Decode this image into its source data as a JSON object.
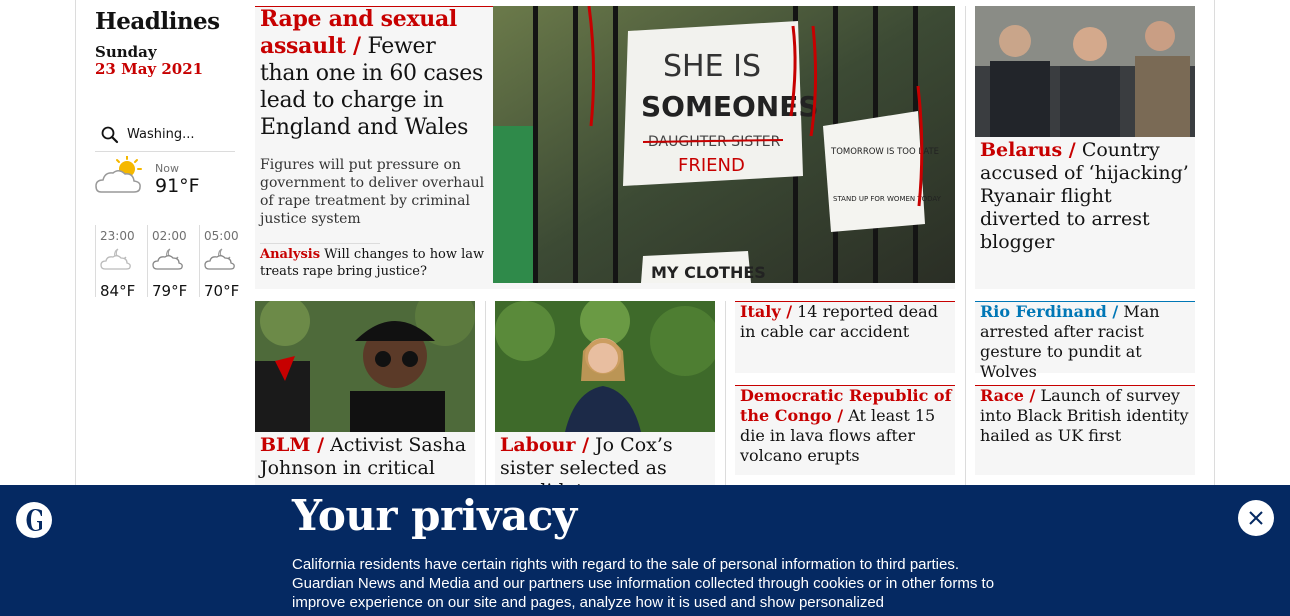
{
  "section": {
    "title": "Headlines",
    "day": "Sunday",
    "date": "23 May 2021"
  },
  "weather": {
    "location": "Washing...",
    "now_label": "Now",
    "now_temp": "91°F",
    "forecast": [
      {
        "time": "23:00",
        "temp": "84°F",
        "icon": "cloud-moon-icon"
      },
      {
        "time": "02:00",
        "temp": "79°F",
        "icon": "cloud-moon-icon"
      },
      {
        "time": "05:00",
        "temp": "70°F",
        "icon": "cloud-moon-icon"
      }
    ]
  },
  "main_story": {
    "kicker": "Rape and sexual assault /",
    "headline": "Fewer than one in 60 cases lead to charge in England and Wales",
    "standfirst": "Figures will put pressure on government to deliver overhaul of rape treatment by criminal justice system",
    "sub_kicker": "Analysis",
    "sub_headline": "Will changes to how law treats rape bring justice?",
    "image_signs": [
      "SHE IS",
      "SOMEONES",
      "DAUGHTER SISTER",
      "FRIEND",
      "TOMORROW IS TOO LATE",
      "STAND UP FOR WOMEN TODAY",
      "MY CLOTHES"
    ]
  },
  "belarus": {
    "kicker": "Belarus /",
    "headline": "Country accused of ‘hijacking’ Ryanair flight diverted to arrest blogger"
  },
  "blm": {
    "kicker": "BLM  /",
    "headline": "Activist Sasha Johnson in critical"
  },
  "labour": {
    "kicker": "Labour /",
    "headline": "Jo Cox’s sister selected as candidate"
  },
  "italy": {
    "kicker": "Italy /",
    "headline": "14 reported dead in cable car accident"
  },
  "drc": {
    "kicker": "Democratic Republic of the Congo /",
    "headline": "At least 15 die in lava flows after volcano erupts"
  },
  "rio": {
    "kicker": "Rio Ferdinand /",
    "headline": "Man arrested after racist gesture to pundit at Wolves"
  },
  "race": {
    "kicker": "Race /",
    "headline": "Launch of survey into Black British identity hailed as UK first"
  },
  "privacy": {
    "title": "Your privacy",
    "text": "California residents have certain rights with regard to the sale of personal information to third parties. Guardian News and Media and our partners use information collected through cookies or in other forms to improve experience on our site and pages, analyze how it is used and show personalized"
  },
  "colors": {
    "news_red": "#c70000",
    "sport_blue": "#0077b6",
    "banner_navy": "#052962"
  }
}
